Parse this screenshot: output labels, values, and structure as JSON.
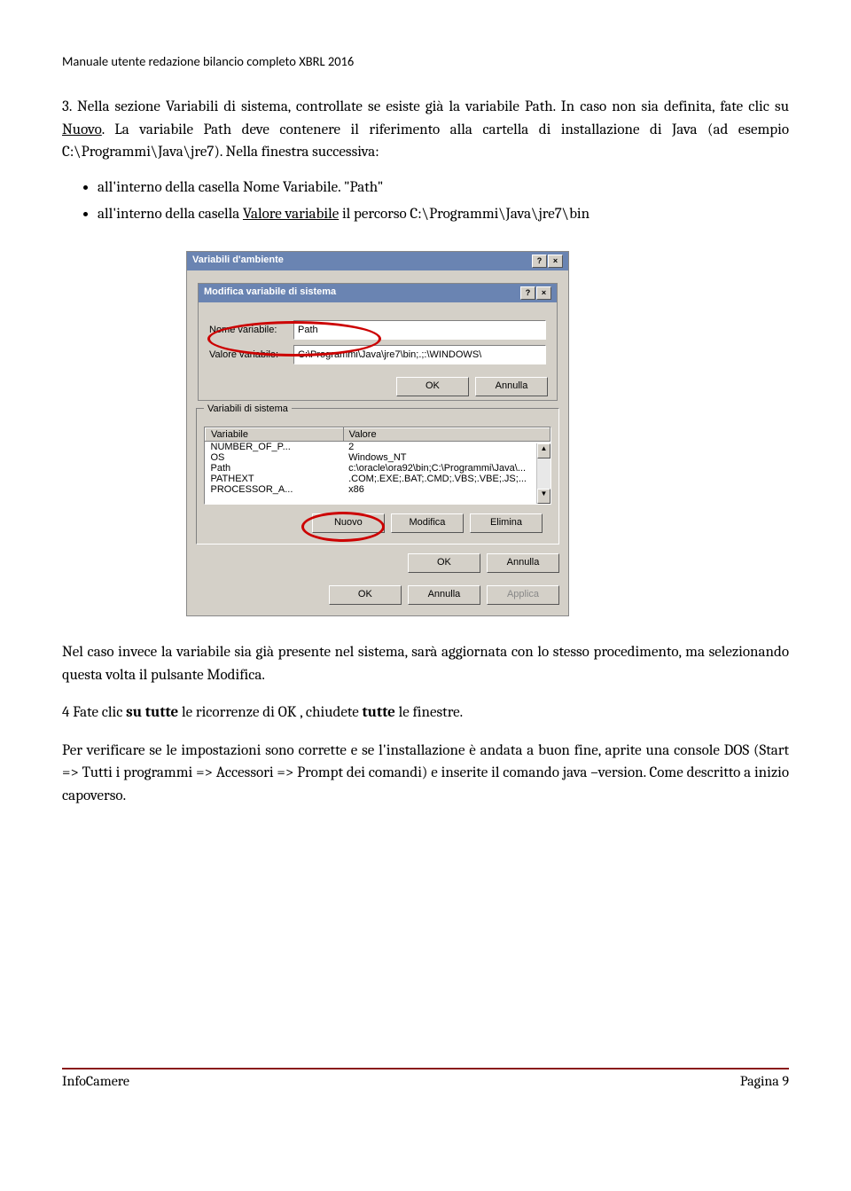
{
  "header": "Manuale utente redazione  bilancio completo  XBRL 2016",
  "body": {
    "p1a": "3. Nella sezione Variabili di sistema, controllate se esiste già la variabile Path. In caso non sia definita,  fate clic su ",
    "p1_nuovo": "Nuovo",
    "p1b": ". La variabile  Path  deve contenere il riferimento alla cartella di installazione di Java (ad esempio  C:\\Programmi\\Java\\jre7).  Nella  finestra successiva:",
    "b1": "all'interno della casella Nome Variabile. \"Path\"",
    "b2a": "all'interno della casella ",
    "b2_underline": "Valore variabile",
    "b2b": "  il percorso  C:\\Programmi\\Java\\jre7\\bin",
    "p2": "Nel caso invece la variabile sia già presente nel sistema,  sarà aggiornata con lo stesso procedimento, ma selezionando questa volta il pulsante Modifica.",
    "p3a": "4  Fate clic ",
    "p3_b1": "su tutte",
    "p3b": " le ricorrenze di OK , chiudete ",
    "p3_b2": "tutte",
    "p3c": " le finestre.",
    "p4": "Per verificare se le impostazioni sono corrette e se l'installazione è andata a buon fine, aprite una console DOS (Start => Tutti i programmi => Accessori => Prompt dei comandi) e inserite il comando java –version. Come descritto a inizio capoverso."
  },
  "dialog": {
    "title_outer": "Variabili d'ambiente",
    "title_inner": "Modifica variabile di sistema",
    "lbl_nome": "Nome variabile:",
    "val_nome": "Path",
    "lbl_valore": "Valore variabile:",
    "val_valore": "C:\\Programmi\\Java\\jre7\\bin;.;:\\WINDOWS\\",
    "btn_ok": "OK",
    "btn_annulla": "Annulla",
    "btn_applica": "Applica",
    "group_title": "Variabili di sistema",
    "col_var": "Variabile",
    "col_val": "Valore",
    "rows": [
      {
        "v": "NUMBER_OF_P...",
        "d": "2"
      },
      {
        "v": "OS",
        "d": "Windows_NT"
      },
      {
        "v": "Path",
        "d": "c:\\oracle\\ora92\\bin;C:\\Programmi\\Java\\..."
      },
      {
        "v": "PATHEXT",
        "d": ".COM;.EXE;.BAT;.CMD;.VBS;.VBE;.JS;..."
      },
      {
        "v": "PROCESSOR_A...",
        "d": "x86"
      }
    ],
    "btn_nuovo": "Nuovo",
    "btn_modifica": "Modifica",
    "btn_elimina": "Elimina"
  },
  "footer": {
    "left": "InfoCamere",
    "right": "Pagina 9"
  }
}
